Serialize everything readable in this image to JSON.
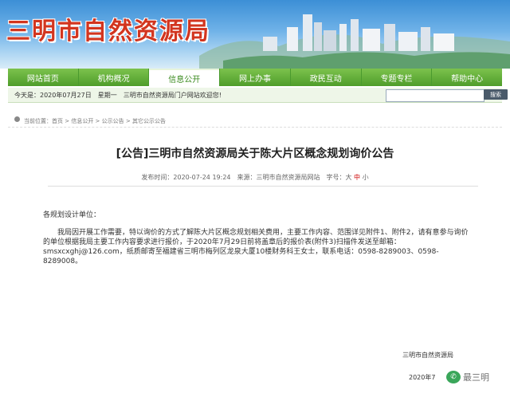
{
  "header": {
    "site_title": "三明市自然资源局",
    "banner_watermark": "三明"
  },
  "nav": {
    "tabs": [
      {
        "label": "网站首页"
      },
      {
        "label": "机构概况"
      },
      {
        "label": "信息公开",
        "active": true
      },
      {
        "label": "网上办事"
      },
      {
        "label": "政民互动"
      },
      {
        "label": "专题专栏"
      },
      {
        "label": "帮助中心"
      }
    ]
  },
  "infobar": {
    "date_text": "今天是：2020年07月27日　星期一　三明市自然资源局门户网站欢迎您!",
    "search_placeholder": "",
    "search_button": "搜索"
  },
  "breadcrumb": {
    "text": "当前位置：首页 > 信息公开 > 公示公告 > 其它公示公告"
  },
  "article": {
    "title": "[公告]三明市自然资源局关于陈大片区概念规划询价公告",
    "meta_left": "发布时间：2020-07-24 19:24　来源：三明市自然资源局网站　字号：大 ",
    "meta_mid": "中",
    "meta_right": " 小",
    "greeting": "各规划设计单位：",
    "body": "我局因开展工作需要，特以询价的方式了解陈大片区概念规划相关费用，主要工作内容、范围详见附件1、附件2，请有意参与询价的单位根据我局主要工作内容要求进行报价，于2020年7月29日前将盖章后的报价表(附件3)扫描件发送至邮箱：smsxcxghj@126.com，纸质邮寄至福建省三明市梅列区龙泉大厦10楼财务科王女士，联系电话：0598-8289003、0598-8289008。",
    "signature": "三明市自然资源局",
    "date": "2020年7"
  },
  "watermark": {
    "text": "最三明"
  },
  "colors": {
    "title_red": "#d2351f",
    "nav_green": "#4f9d2a",
    "banner_blue": "#3c8fd6"
  }
}
